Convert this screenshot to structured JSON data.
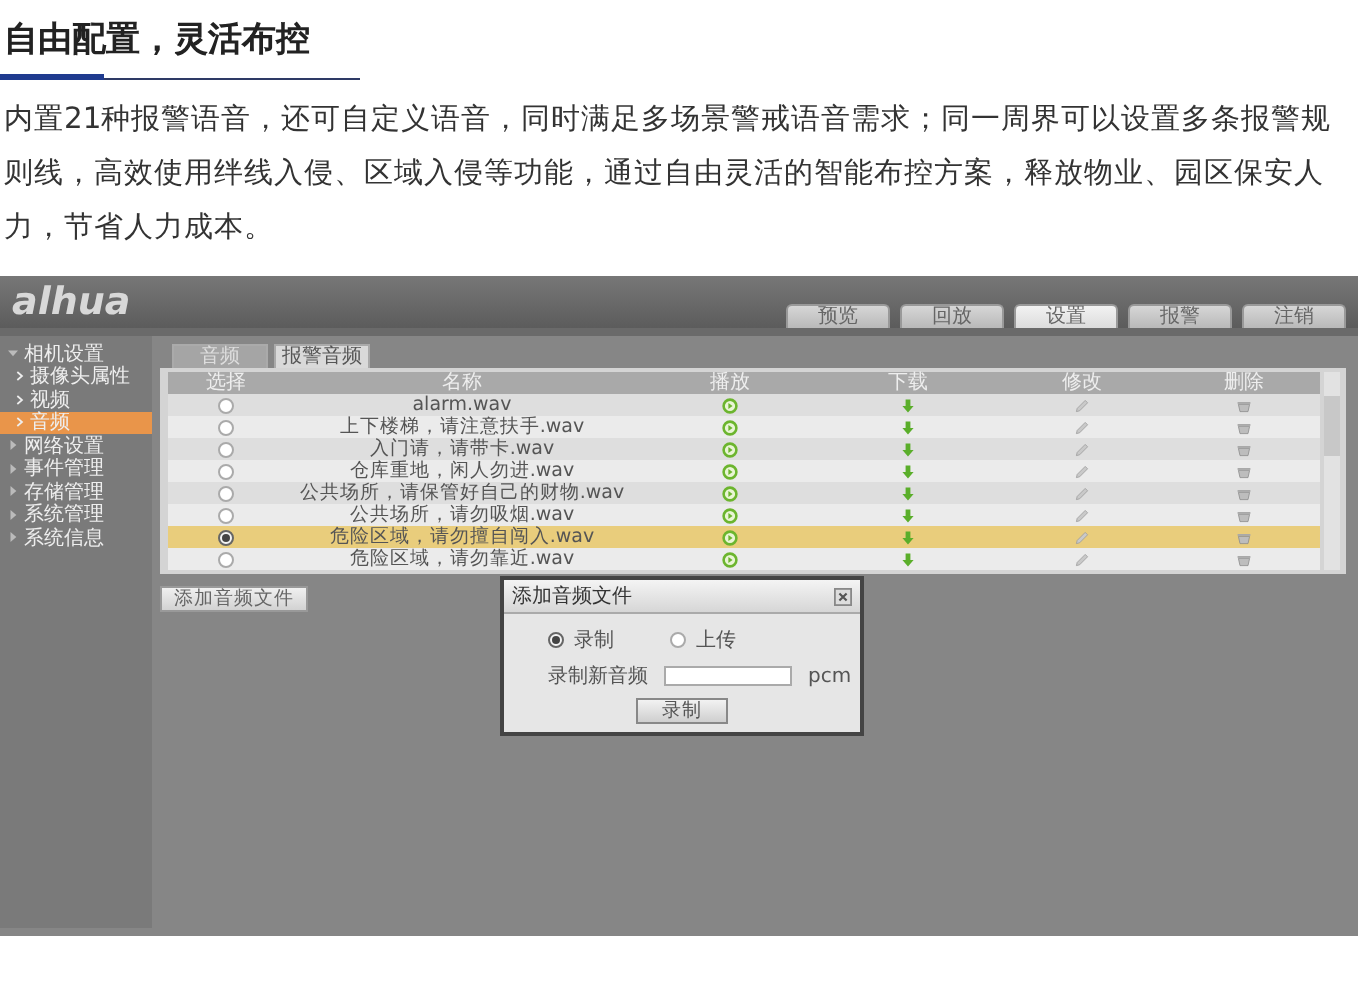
{
  "article": {
    "heading": "自由配置，灵活布控",
    "paragraph": "内置21种报警语音，还可自定义语音，同时满足多场景警戒语音需求；同一周界可以设置多条报警规则线，高效使用绊线入侵、区域入侵等功能，通过自由灵活的智能布控方案，释放物业、园区保安人力，节省人力成本。"
  },
  "app": {
    "logo": "alhua",
    "top_tabs": [
      {
        "label": "预览",
        "selected": false
      },
      {
        "label": "回放",
        "selected": false
      },
      {
        "label": "设置",
        "selected": true
      },
      {
        "label": "报警",
        "selected": false
      },
      {
        "label": "注销",
        "selected": false
      }
    ],
    "sidebar": [
      {
        "label": "相机设置",
        "expanded": true,
        "selected": false,
        "children": [
          {
            "label": "摄像头属性",
            "selected": false
          },
          {
            "label": "视频",
            "selected": false
          },
          {
            "label": "音频",
            "selected": true
          }
        ]
      },
      {
        "label": "网络设置",
        "expanded": false,
        "selected": false
      },
      {
        "label": "事件管理",
        "expanded": false,
        "selected": false
      },
      {
        "label": "存储管理",
        "expanded": false,
        "selected": false
      },
      {
        "label": "系统管理",
        "expanded": false,
        "selected": false
      },
      {
        "label": "系统信息",
        "expanded": false,
        "selected": false
      }
    ],
    "sub_tabs": [
      {
        "label": "音频",
        "selected": false
      },
      {
        "label": "报警音频",
        "selected": true
      }
    ],
    "table": {
      "columns": [
        "选择",
        "名称",
        "播放",
        "下载",
        "修改",
        "删除"
      ],
      "rows": [
        {
          "name": "alarm.wav",
          "selected": false
        },
        {
          "name": "上下楼梯，请注意扶手.wav",
          "selected": false
        },
        {
          "name": "入门请，请带卡.wav",
          "selected": false
        },
        {
          "name": "仓库重地，闲人勿进.wav",
          "selected": false
        },
        {
          "name": "公共场所，请保管好自己的财物.wav",
          "selected": false
        },
        {
          "name": "公共场所，请勿吸烟.wav",
          "selected": false
        },
        {
          "name": "危险区域，请勿擅自闯入.wav",
          "selected": true
        },
        {
          "name": "危险区域，请勿靠近.wav",
          "selected": false
        }
      ]
    },
    "add_button": "添加音频文件",
    "dialog": {
      "title": "添加音频文件",
      "options": [
        {
          "label": "录制",
          "selected": true
        },
        {
          "label": "上传",
          "selected": false
        }
      ],
      "field_label": "录制新音频",
      "unit": "pcm",
      "button": "录制"
    }
  }
}
